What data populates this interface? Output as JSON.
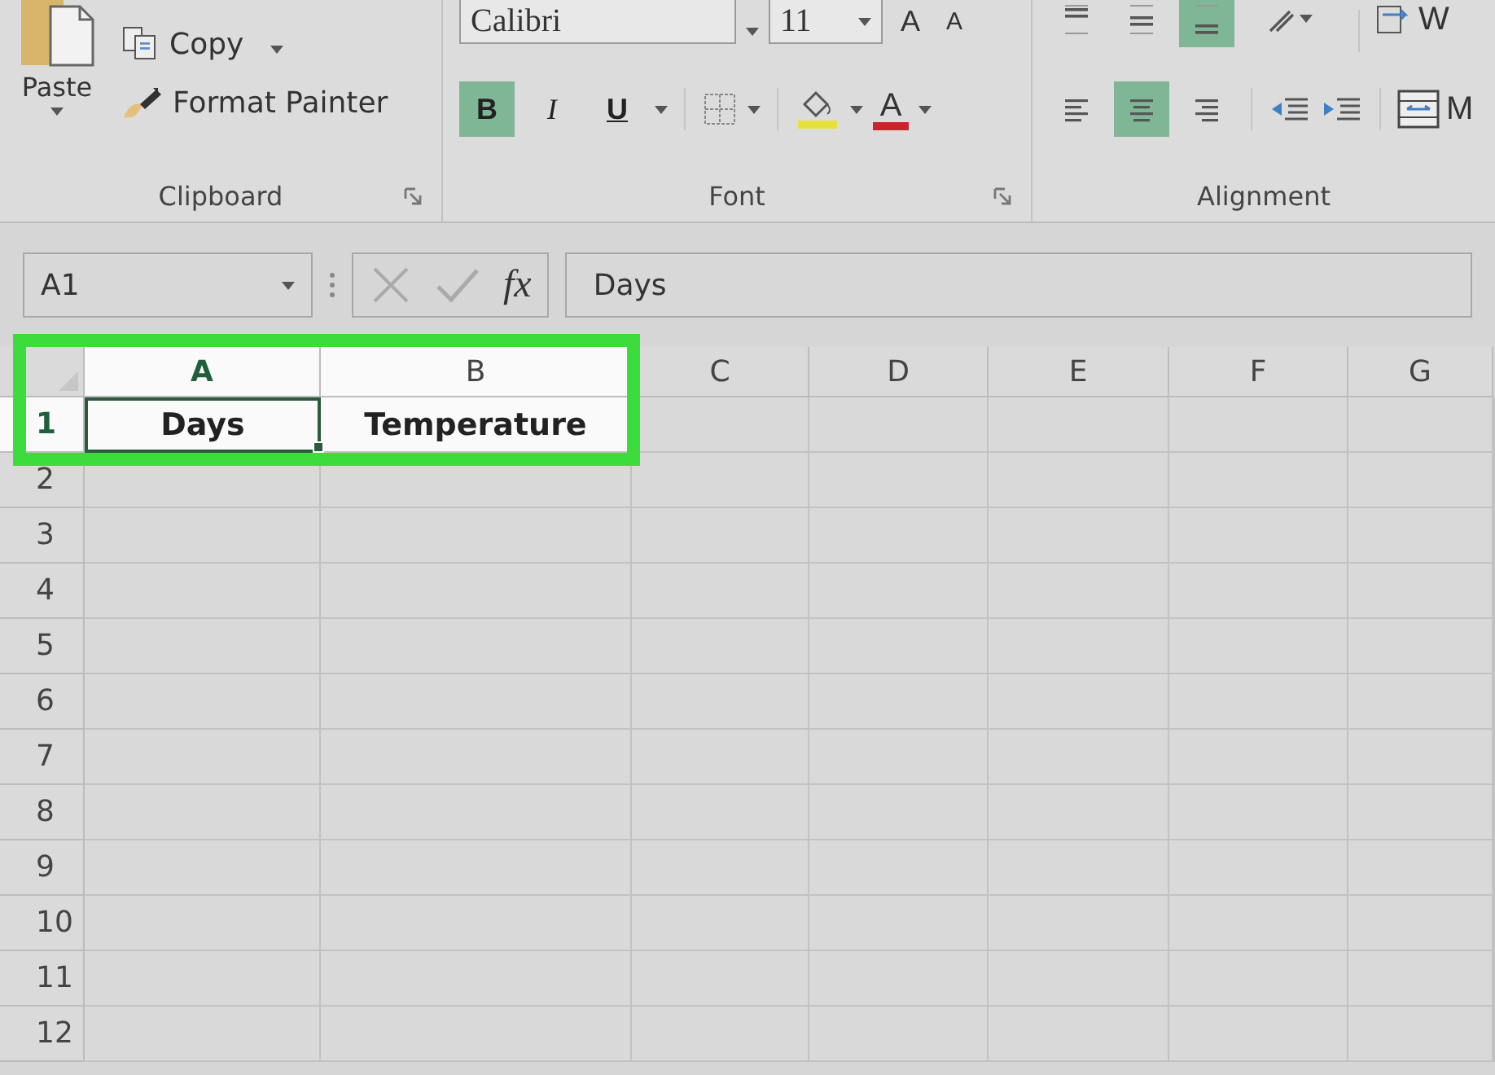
{
  "ribbon": {
    "groups": [
      {
        "kind": "clipboard",
        "label": "Clipboard",
        "paste": "Paste",
        "copy": "Copy",
        "format_painter": "Format Painter"
      },
      {
        "kind": "font",
        "label": "Font",
        "font_name": "Calibri",
        "font_size": "11",
        "grow": "A",
        "shrink": "A",
        "styles": [
          {
            "label": "B",
            "selected": true
          },
          {
            "label": "I",
            "selected": false
          },
          {
            "label": "U",
            "selected": false
          }
        ],
        "font_color": "A"
      },
      {
        "kind": "alignment",
        "label": "Alignment",
        "vertical": [
          {
            "selected": false
          },
          {
            "selected": false
          },
          {
            "selected": true
          }
        ],
        "horizontal": [
          {
            "selected": false
          },
          {
            "selected": true
          },
          {
            "selected": false
          }
        ],
        "wrap": "W",
        "merge": "M"
      }
    ]
  },
  "formula_bar": {
    "name_box": "A1",
    "function_label": "fx",
    "value": "Days"
  },
  "grid": {
    "columns": [
      {
        "label": "A",
        "selected": true,
        "highlighted": true
      },
      {
        "label": "B",
        "selected": false,
        "highlighted": true
      },
      {
        "label": "C",
        "selected": false,
        "highlighted": false
      },
      {
        "label": "D",
        "selected": false,
        "highlighted": false
      },
      {
        "label": "E",
        "selected": false,
        "highlighted": false
      },
      {
        "label": "F",
        "selected": false,
        "highlighted": false
      },
      {
        "label": "G",
        "selected": false,
        "highlighted": false
      }
    ],
    "rows": [
      {
        "label": "1",
        "selected": true,
        "highlighted": true,
        "cells": [
          {
            "text": "Days",
            "selected": true
          },
          {
            "text": "Temperature",
            "selected": false
          }
        ]
      },
      {
        "label": "2",
        "selected": false,
        "highlighted": false
      },
      {
        "label": "3",
        "selected": false,
        "highlighted": false
      },
      {
        "label": "4",
        "selected": false,
        "highlighted": false
      },
      {
        "label": "5",
        "selected": false,
        "highlighted": false
      },
      {
        "label": "6",
        "selected": false,
        "highlighted": false
      },
      {
        "label": "7",
        "selected": false,
        "highlighted": false
      },
      {
        "label": "8",
        "selected": false,
        "highlighted": false
      },
      {
        "label": "9",
        "selected": false,
        "highlighted": false
      },
      {
        "label": "10",
        "selected": false,
        "highlighted": false
      },
      {
        "label": "11",
        "selected": false,
        "highlighted": false
      },
      {
        "label": "12",
        "selected": false,
        "highlighted": false
      }
    ]
  }
}
